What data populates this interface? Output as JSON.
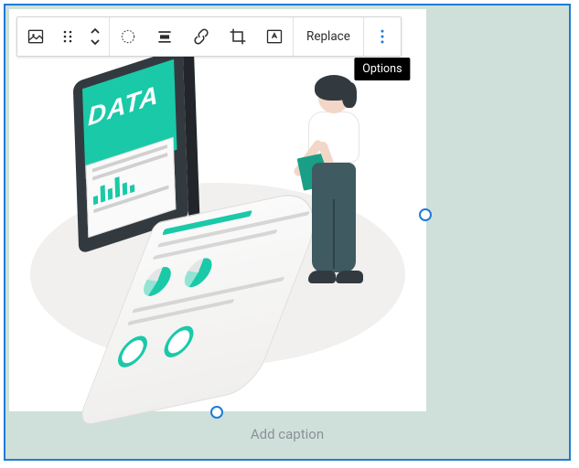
{
  "toolbar": {
    "replace_label": "Replace",
    "options_tooltip": "Options"
  },
  "illustration": {
    "headline": "DATA"
  },
  "caption": {
    "placeholder": "Add caption"
  }
}
